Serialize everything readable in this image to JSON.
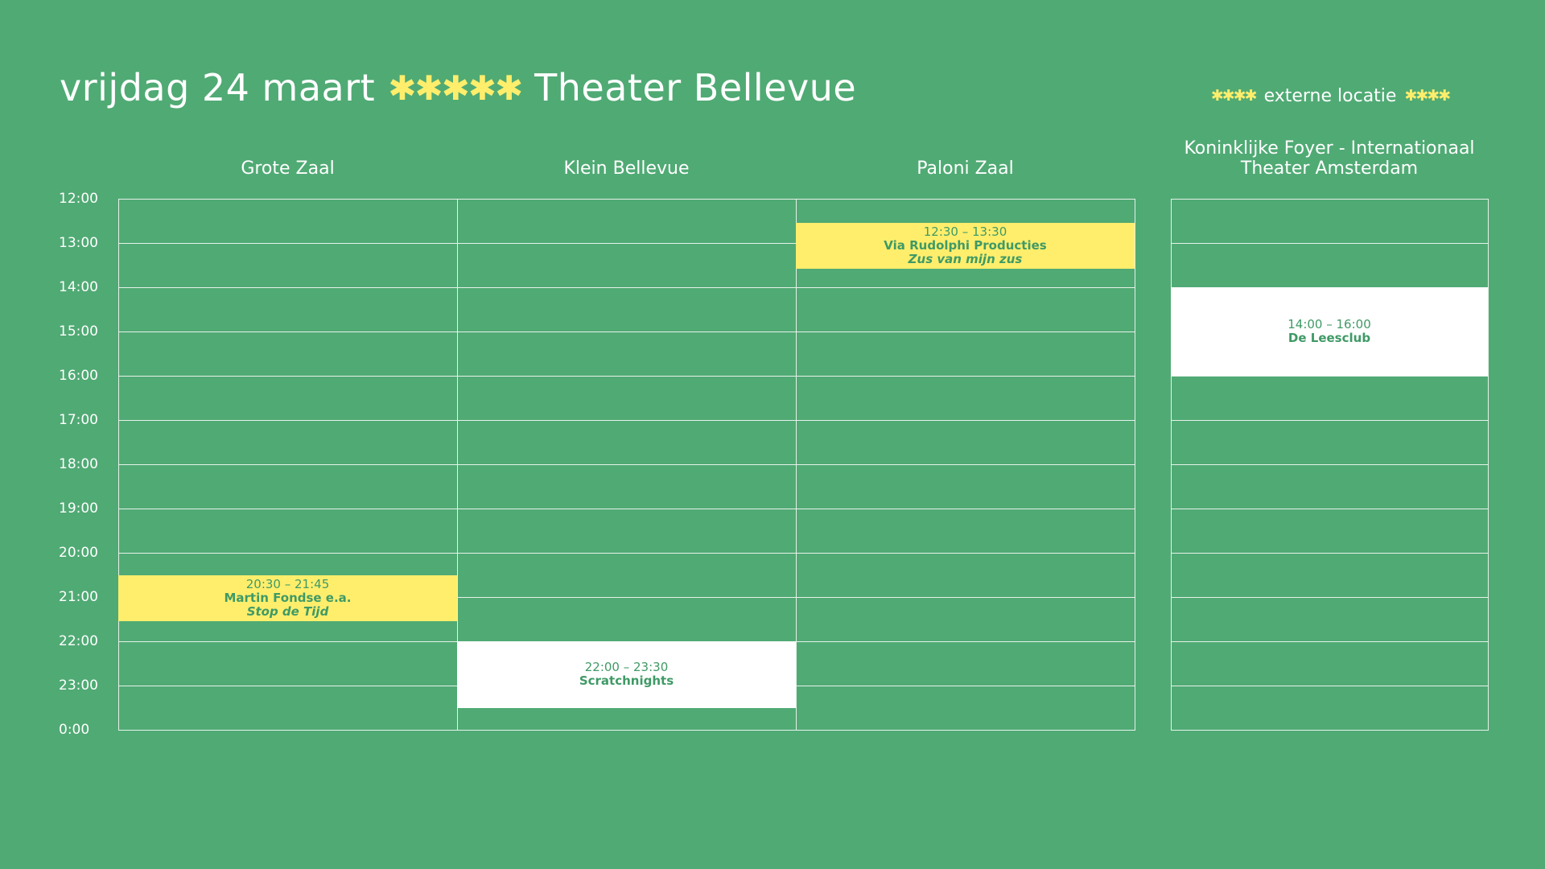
{
  "header": {
    "date": "vrijdag 24 maart",
    "stars": "✱✱✱✱✱",
    "venue": "Theater Bellevue"
  },
  "legend": {
    "stars_left": "✱✱✱✱",
    "label": "externe locatie",
    "stars_right": "✱✱✱✱"
  },
  "rooms": [
    {
      "name": "Grote Zaal"
    },
    {
      "name": "Klein Bellevue"
    },
    {
      "name": "Paloni Zaal"
    },
    {
      "name_line1": "Koninklijke Foyer - Internationaal",
      "name_line2": "Theater Amsterdam"
    }
  ],
  "times": [
    "12:00",
    "13:00",
    "14:00",
    "15:00",
    "16:00",
    "17:00",
    "18:00",
    "19:00",
    "20:00",
    "21:00",
    "22:00",
    "23:00",
    "0:00"
  ],
  "events": [
    {
      "room": 0,
      "start": 20.5,
      "end": 21.55,
      "style": "yellow",
      "time": "20:30 – 21:45",
      "company": "Martin Fondse e.a.",
      "show": "Stop de Tijd"
    },
    {
      "room": 1,
      "start": 22.0,
      "end": 23.5,
      "style": "white",
      "time": "22:00 – 23:30",
      "company": "Scratchnights"
    },
    {
      "room": 2,
      "start": 12.55,
      "end": 13.58,
      "style": "yellow",
      "time": "12:30 – 13:30",
      "company": "Via Rudolphi Producties",
      "show": "Zus van mijn zus"
    },
    {
      "room": 3,
      "start": 14.0,
      "end": 16.0,
      "style": "white",
      "time": "14:00 – 16:00",
      "company": "De Leesclub"
    }
  ],
  "colors": {
    "background": "#50aa74",
    "accent_yellow": "#ffee6c",
    "event_text": "#3f9a66",
    "grid_line": "#e6f2ea"
  }
}
